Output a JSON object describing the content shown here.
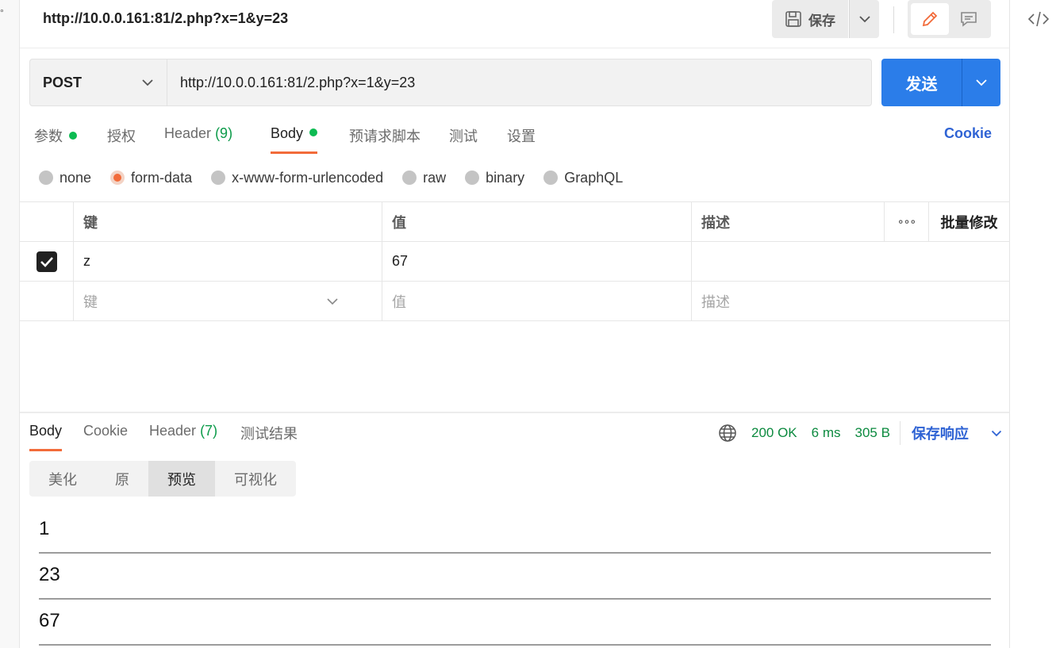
{
  "tab": {
    "title": "http://10.0.0.161:81/2.php?x=1&y=23",
    "save_label": "保存"
  },
  "request": {
    "method": "POST",
    "url": "http://10.0.0.161:81/2.php?x=1&y=23",
    "send_label": "发送"
  },
  "req_tabs": {
    "params": "参数",
    "auth": "授权",
    "header": "Header",
    "header_count": "(9)",
    "body": "Body",
    "pre_script": "预请求脚本",
    "tests": "测试",
    "settings": "设置",
    "cookie": "Cookie"
  },
  "body_types": {
    "none": "none",
    "form_data": "form-data",
    "urlencoded": "x-www-form-urlencoded",
    "raw": "raw",
    "binary": "binary",
    "graphql": "GraphQL",
    "selected": "form-data"
  },
  "kv_table": {
    "headers": {
      "key": "键",
      "value": "值",
      "description": "描述",
      "more": "∘∘∘",
      "bulk_edit": "批量修改"
    },
    "rows": [
      {
        "key": "z",
        "value": "67",
        "description": "",
        "checked": true
      }
    ],
    "placeholders": {
      "key": "键",
      "value": "值",
      "description": "描述"
    }
  },
  "response": {
    "tabs": {
      "body": "Body",
      "cookie": "Cookie",
      "header": "Header",
      "header_count": "(7)",
      "test_results": "测试结果"
    },
    "status": "200 OK",
    "time": "6 ms",
    "size": "305 B",
    "save_label": "保存响应",
    "view_modes": [
      "美化",
      "原",
      "预览",
      "可视化"
    ],
    "active_view": "预览",
    "preview_lines": [
      "1",
      "23",
      "67"
    ]
  },
  "colors": {
    "accent": "#f26b3a",
    "primary": "#2b7de9",
    "link": "#2f63d4",
    "success": "#0c8a3f",
    "indicator": "#0cbb52"
  }
}
